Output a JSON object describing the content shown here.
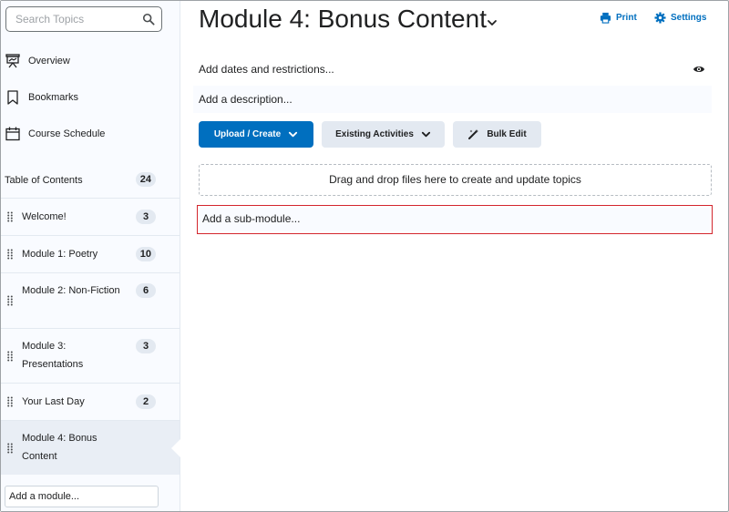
{
  "sidebar": {
    "search": {
      "placeholder": "Search Topics"
    },
    "nav": [
      {
        "label": "Overview",
        "icon": "presentation-icon"
      },
      {
        "label": "Bookmarks",
        "icon": "bookmark-icon"
      },
      {
        "label": "Course Schedule",
        "icon": "calendar-icon"
      }
    ],
    "toc": {
      "label": "Table of Contents",
      "count": "24"
    },
    "modules": [
      {
        "label": "Welcome!",
        "count": "3"
      },
      {
        "label": "Module 1: Poetry",
        "count": "10"
      },
      {
        "label": "Module 2: Non-Fiction",
        "count": "6"
      },
      {
        "label": "Module 3: Presentations",
        "count": "3"
      },
      {
        "label": "Your Last Day",
        "count": "2"
      },
      {
        "label": "Module 4: Bonus Content",
        "count": "",
        "selected": true
      }
    ],
    "add_module_placeholder": "Add a module..."
  },
  "main": {
    "title": "Module 4: Bonus Content",
    "print_label": "Print",
    "settings_label": "Settings",
    "dates_label": "Add dates and restrictions...",
    "description_placeholder": "Add a description...",
    "buttons": {
      "upload_create": "Upload / Create",
      "existing_activities": "Existing Activities",
      "bulk_edit": "Bulk Edit"
    },
    "dropzone_label": "Drag and drop files here to create and update topics",
    "submodule_placeholder": "Add a sub-module..."
  },
  "colors": {
    "accent": "#006fbf",
    "highlight_border": "#d3262d",
    "sidebar_bg": "#f9fbff",
    "selected_bg": "#e9eef5",
    "secondary_button": "#e3e9f1"
  }
}
